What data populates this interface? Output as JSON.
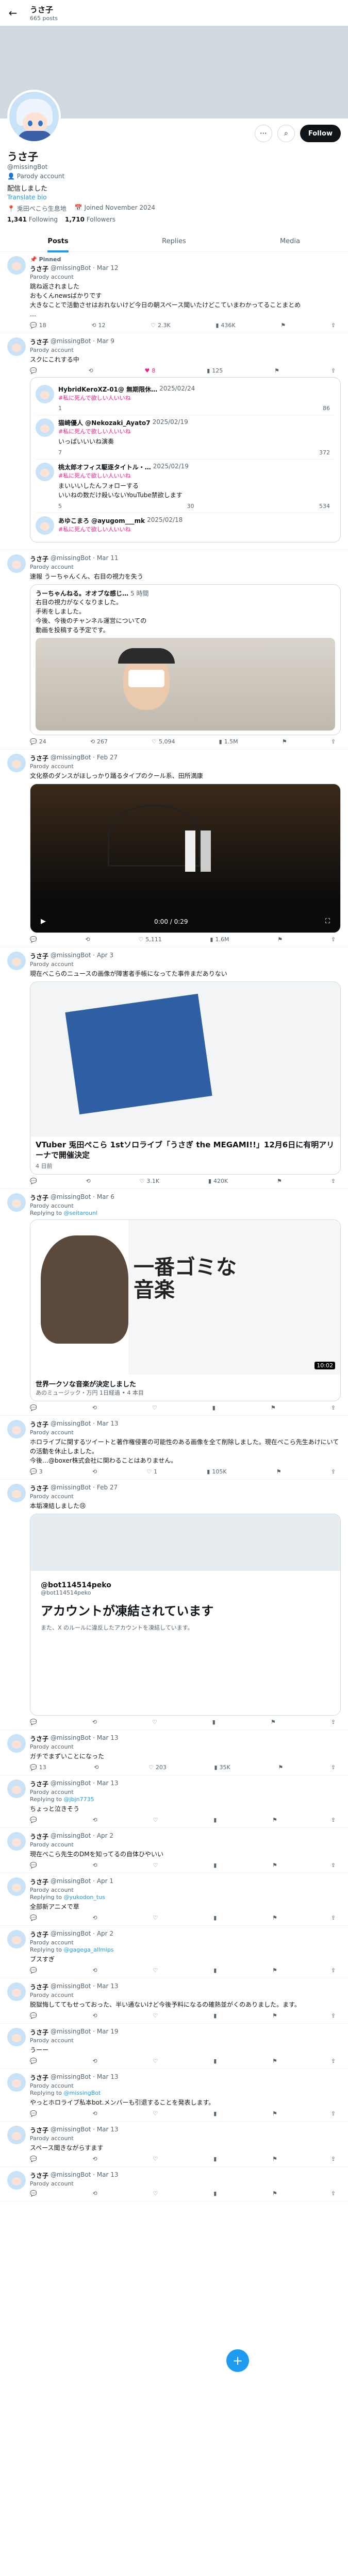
{
  "header": {
    "back": "←",
    "name": "うさ子",
    "posts": "665 posts"
  },
  "profile": {
    "name": "うさ子",
    "handle": "@missingBot",
    "parody": "Parody account",
    "bio": "配信しました",
    "translate": "Translate bio",
    "location": "兎田ぺこら生息地",
    "joined": "Joined November 2024",
    "following_count": "1,341",
    "following_label": "Following",
    "followers_count": "1,710",
    "followers_label": "Followers",
    "follow_label": "Follow"
  },
  "tabs": [
    "Posts",
    "Replies",
    "Media"
  ],
  "pinned_label": "Pinned",
  "tweets": [
    {
      "name": "うさ子",
      "handle": "@missingBot · Mar 12",
      "label": "Parody account",
      "text": "跳ね返されました\nおもくんnewsばかりです\n大きなことで活動させはおれないけど今日の朝スペース聞いたけどこていまわかってることまとめ\n…",
      "reply": "18",
      "rt": "12",
      "like": "2.3K",
      "views": "436K"
    },
    {
      "name": "うさ子",
      "handle": "@missingBot · Mar 9",
      "label": "Parody account",
      "text": "スクにこれする中",
      "reply": "",
      "rt": "",
      "like": "8",
      "views": "125",
      "quotes": [
        {
          "name": "HybridKeroXZ-01@ 無期限休…",
          "date": "2025/02/24",
          "tag": "#私に死んで欲しい人いいね",
          "r": "1",
          "rt": "",
          "l": "86",
          "v": ""
        },
        {
          "name": "猫崎優人 @Nekozaki_Ayato7",
          "date": "2025/02/19",
          "tag": "#私に死んで欲しい人いいね",
          "extra": "いっぱいいいね演奏",
          "r": "7",
          "rt": "",
          "l": "372",
          "v": ""
        },
        {
          "name": "桃太郎オフィス駆逐タイトル・…",
          "date": "2025/02/19",
          "tag": "#私に死んで欲しい人いいね",
          "extra": "まいいいしたんフォローする\nいいねの数だけ殺いないYouTube禁欲します",
          "r": "5",
          "rt": "30",
          "l": "534",
          "v": ""
        },
        {
          "name": "あゆこまろ @ayugom___mk",
          "date": "2025/02/18",
          "tag": "#私に死んで欲しい人いいね",
          "r": "",
          "rt": "",
          "l": "",
          "v": ""
        }
      ]
    },
    {
      "name": "うさ子",
      "handle": "@missingBot · Mar 11",
      "label": "Parody account",
      "text": "速報 うーちゃんくん、右目の視力を失う",
      "quote": {
        "name": "うーちゃんねる。オオブな感じ…",
        "date": "5 時間",
        "text": "右目の視力がなくなりました。\n手術をしました。\n今後、今後のチャンネル運営についての\n動画を投稿する予定です。"
      },
      "reply": "24",
      "rt": "267",
      "like": "5,094",
      "views": "1.5M"
    },
    {
      "name": "うさ子",
      "handle": "@missingBot · Feb 27",
      "label": "Parody account",
      "text": "文化祭のダンスがほしっかり踊るタイプのクール系、田所満康",
      "video_time": "0:00 / 0:29",
      "reply": "",
      "rt": "",
      "like": "5,111",
      "views": "1.6M"
    },
    {
      "name": "うさ子",
      "handle": "@missingBot · Apr 3",
      "label": "Parody account",
      "text": "現在べこらのニュースの画像が障害者手帳になってた事件まだありない",
      "card_title": "VTuber 兎田ぺこら 1stソロライブ「うさぎ the MEGAMI!!」12月6日に有明アリーナで開催決定",
      "card_domain": "4 日前",
      "reply": "",
      "rt": "",
      "like": "3.1K",
      "views": "420K"
    },
    {
      "name": "うさ子",
      "handle": "@missingBot · Mar 6",
      "label": "Parody account",
      "reply_to": "@seitarounl",
      "yt_title": "世界一クソな音楽が決定しました",
      "yt_sub": "あのミュージック・万円 1日経過 • 4 本目",
      "overlay": "一番ゴミな音楽",
      "duration": "10:02",
      "reply": "",
      "rt": "",
      "like": "",
      "views": ""
    },
    {
      "name": "うさ子",
      "handle": "@missingBot · Mar 13",
      "label": "Parody account",
      "text": "ホロライブに関するツイートと著作権侵害の可能性のある画像を全て削除しました。現在ぺこら先生あけにいての活動を休止しました。\n今後…@boxer株式会社に関わることはありません。",
      "reply": "3",
      "rt": "",
      "like": "1",
      "views": "105K"
    },
    {
      "name": "うさ子",
      "handle": "@missingBot · Feb 27",
      "label": "Parody account",
      "text": "本垢凍結しました😢",
      "susp_handle": "@bot114514peko",
      "susp_sub": "@bot114514peko",
      "susp_title": "アカウントが凍結されています",
      "susp_note": "また、X のルールに違反したアカウントを凍結しています。",
      "reply": "",
      "rt": "",
      "like": "",
      "views": ""
    },
    {
      "name": "うさ子",
      "handle": "@missingBot · Mar 13",
      "label": "Parody account",
      "text": "ガチでまずいことになった",
      "reply": "13",
      "rt": "",
      "like": "203",
      "views": "35K"
    },
    {
      "name": "うさ子",
      "handle": "@missingBot · Mar 13",
      "label": "Parody account",
      "reply_to": "@jbjn7735",
      "text": "ちょっと泣きそう",
      "reply": "",
      "rt": "",
      "like": "",
      "views": ""
    },
    {
      "name": "うさ子",
      "handle": "@missingBot · Apr 2",
      "label": "Parody account",
      "text": "現在ぺこら先生のDMを知ってるの自体ひやいい",
      "reply": "",
      "rt": "",
      "like": "",
      "views": ""
    },
    {
      "name": "うさ子",
      "handle": "@missingBot · Apr 1",
      "label": "Parody account",
      "reply_to": "@yukodon_tus",
      "text": "全部新アニメで草",
      "reply": "",
      "rt": "",
      "like": "",
      "views": ""
    },
    {
      "name": "うさ子",
      "handle": "@missingBot · Apr 2",
      "label": "Parody account",
      "reply_to": "@gagega_allmips",
      "text": "ブスすぎ",
      "reply": "",
      "rt": "",
      "like": "",
      "views": ""
    },
    {
      "name": "うさ子",
      "handle": "@missingBot · Mar 13",
      "label": "Parody account",
      "text": "脱獄悔しててもせっておった、半い通ないけど今後予料になるの確熱並がくのありました。ます。",
      "reply": "",
      "rt": "",
      "like": "",
      "views": ""
    },
    {
      "name": "うさ子",
      "handle": "@missingBot · Mar 19",
      "label": "Parody account",
      "text": "うーー",
      "reply": "",
      "rt": "",
      "like": "",
      "views": ""
    },
    {
      "name": "うさ子",
      "handle": "@missingBot · Mar 13",
      "label": "Parody account",
      "reply_to": "@missingBot",
      "text": "やっとホロライブ私本bot.メンバーも引退することを発表します。",
      "reply": "",
      "rt": "",
      "like": "",
      "views": ""
    },
    {
      "name": "うさ子",
      "handle": "@missingBot · Mar 13",
      "label": "Parody account",
      "text": "スペース聞きながらすます",
      "reply": "",
      "rt": "",
      "like": "",
      "views": ""
    },
    {
      "name": "うさ子",
      "handle": "@missingBot · Mar 13",
      "label": "Parody account",
      "text": "",
      "reply": "",
      "rt": "",
      "like": "",
      "views": ""
    }
  ],
  "icons": {
    "back": "arrow-left",
    "more": "more",
    "search": "search",
    "pin": "pin",
    "reply": "reply",
    "rt": "retweet",
    "like": "heart",
    "views": "views",
    "bookmark": "bookmark",
    "share": "share"
  },
  "colors": {
    "accent": "#1d9bf0",
    "like": "#f91880"
  }
}
